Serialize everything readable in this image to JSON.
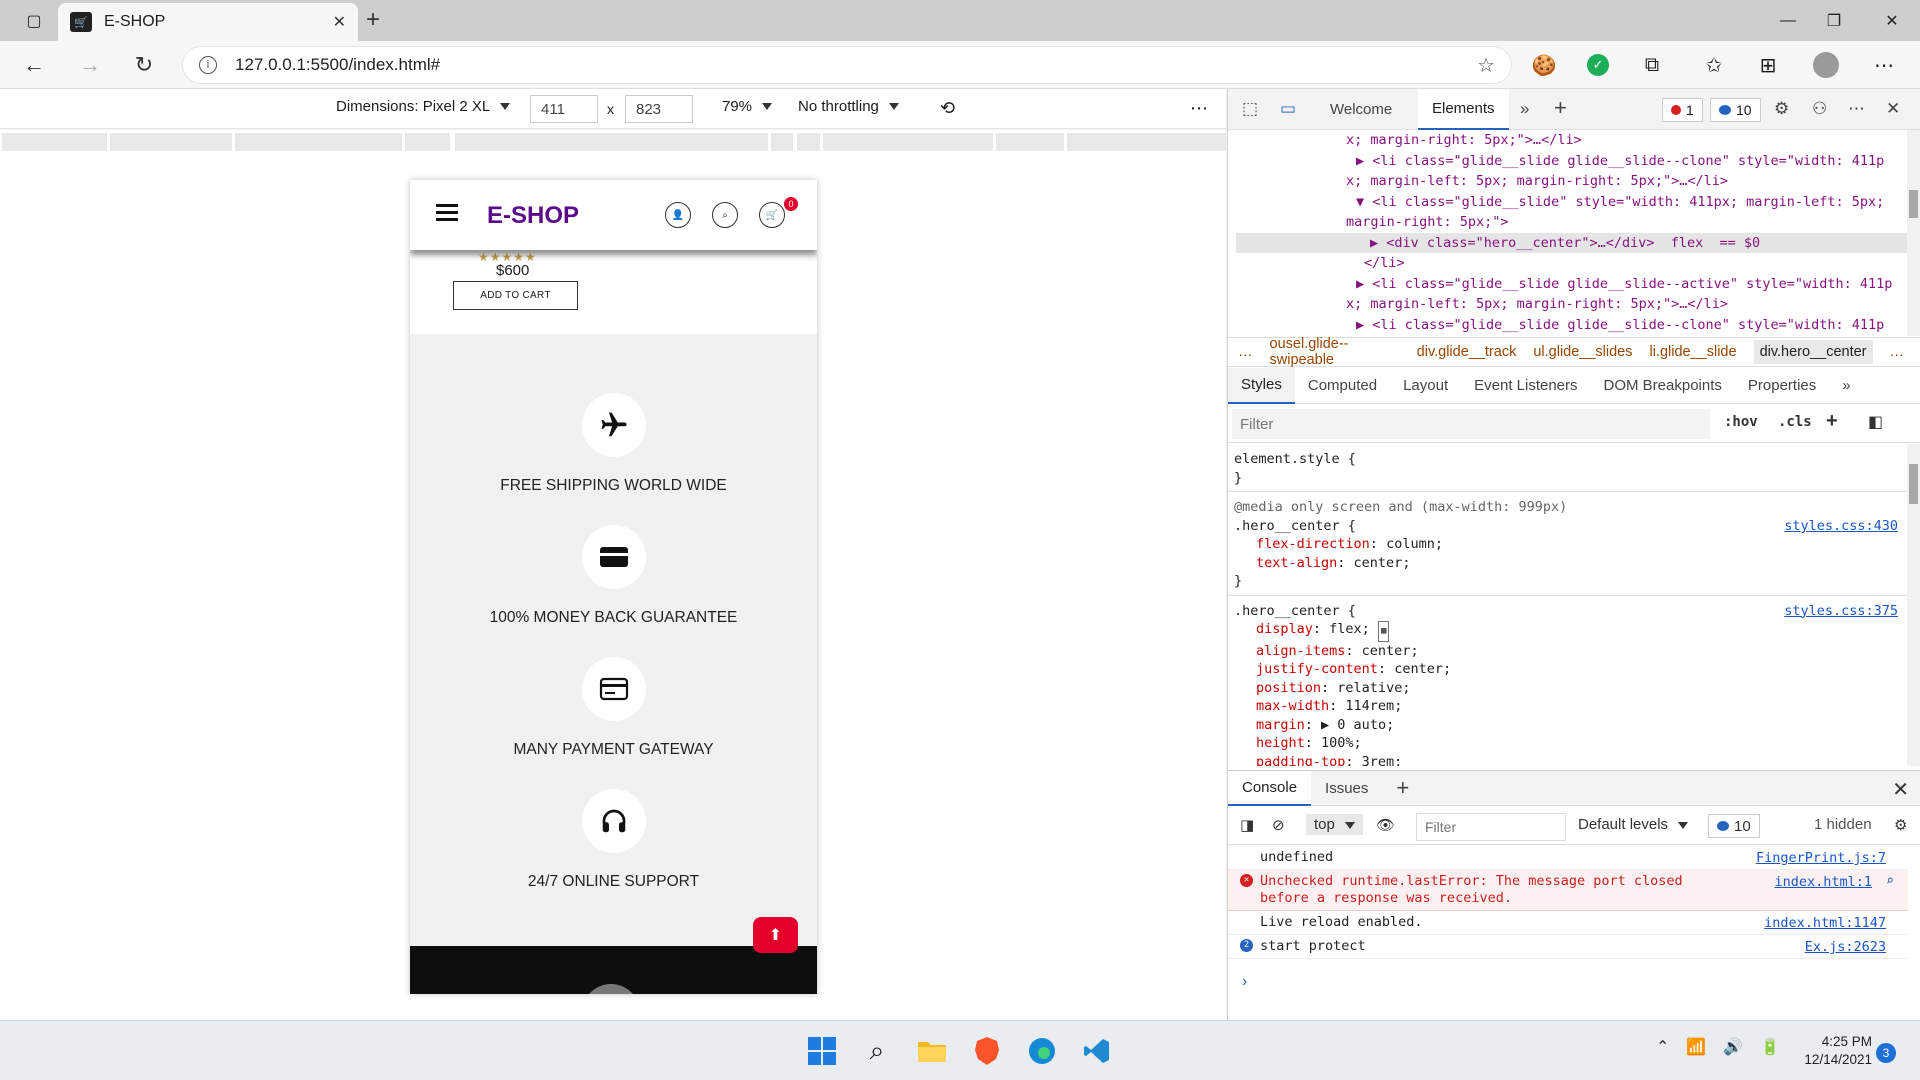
{
  "browser": {
    "tab_title": "E-SHOP",
    "url": "127.0.0.1:5500/index.html#"
  },
  "emulation": {
    "dimensions_label": "Dimensions: Pixel 2 XL",
    "width": "411",
    "height": "823",
    "times": "x",
    "zoom": "79%",
    "throttling": "No throttling"
  },
  "site": {
    "logo": "E-SHOP",
    "cart_count": "0",
    "stars": "★★★★★",
    "price": "$600",
    "add_to_cart": "ADD TO CART",
    "features": [
      {
        "label": "FREE SHIPPING WORLD WIDE",
        "icon": "airplane-icon"
      },
      {
        "label": "100% MONEY BACK GUARANTEE",
        "icon": "credit-card-icon"
      },
      {
        "label": "MANY PAYMENT GATEWAY",
        "icon": "payment-card-icon"
      },
      {
        "label": "24/7 ONLINE SUPPORT",
        "icon": "headphones-icon"
      }
    ]
  },
  "devtools": {
    "tabs": {
      "welcome": "Welcome",
      "elements": "Elements"
    },
    "error_count": "1",
    "info_count": "10",
    "dom_lines": [
      "x; margin-right: 5px;\">…</li>",
      "▶ <li class=\"glide__slide glide__slide--clone\" style=\"width: 411p",
      "x; margin-left: 5px; margin-right: 5px;\">…</li>",
      "▼ <li class=\"glide__slide\" style=\"width: 411px; margin-left: 5px;",
      "margin-right: 5px;\">",
      "▶ <div class=\"hero__center\">…</div>  flex  == $0",
      "</li>",
      "▶ <li class=\"glide__slide glide__slide--active\" style=\"width: 411p",
      "x; margin-left: 5px; margin-right: 5px;\">…</li>",
      "▶ <li class=\"glide__slide glide__slide--clone\" style=\"width: 411p"
    ],
    "breadcrumbs": [
      "…",
      "ousel.glide--swipeable",
      "div.glide__track",
      "ul.glide__slides",
      "li.glide__slide",
      "div.hero__center",
      "…"
    ],
    "sub_tabs": [
      "Styles",
      "Computed",
      "Layout",
      "Event Listeners",
      "DOM Breakpoints",
      "Properties",
      "»"
    ],
    "styles_filter_placeholder": "Filter",
    "hov": ":hov",
    "cls": ".cls",
    "element_style": "element.style {",
    "close_brace": "}",
    "media_query": "@media only screen and (max-width: 999px)",
    "rule1": {
      "selector": ".hero__center {",
      "source": "styles.css:430",
      "props": [
        {
          "name": "flex-direction",
          "value": "column;"
        },
        {
          "name": "text-align",
          "value": "center;"
        }
      ]
    },
    "rule2": {
      "selector": ".hero__center {",
      "source": "styles.css:375",
      "props": [
        {
          "name": "display",
          "value": "flex;"
        },
        {
          "name": "align-items",
          "value": "center;"
        },
        {
          "name": "justify-content",
          "value": "center;"
        },
        {
          "name": "position",
          "value": "relative;"
        },
        {
          "name": "max-width",
          "value": "114rem;"
        },
        {
          "name": "margin",
          "value": "▶ 0 auto;"
        },
        {
          "name": "height",
          "value": "100%;"
        },
        {
          "name": "padding-top",
          "value": "3rem;"
        }
      ]
    },
    "drawer_tabs": {
      "console": "Console",
      "issues": "Issues"
    },
    "console_context": "top",
    "console_filter_placeholder": "Filter",
    "default_levels": "Default levels",
    "console_info_count": "10",
    "hidden_count": "1 hidden",
    "messages": [
      {
        "text": "undefined",
        "source": "FingerPrint.js:7"
      },
      {
        "text": "Unchecked runtime.lastError: The message port closed before a response was received.",
        "source": "index.html:1"
      },
      {
        "text": "Live reload enabled.",
        "source": "index.html:1147"
      },
      {
        "text": "start protect",
        "source": "Ex.js:2623",
        "count": "2"
      }
    ],
    "prompt": "›"
  },
  "taskbar": {
    "time": "4:25 PM",
    "date": "12/14/2021",
    "notifications": "3"
  }
}
